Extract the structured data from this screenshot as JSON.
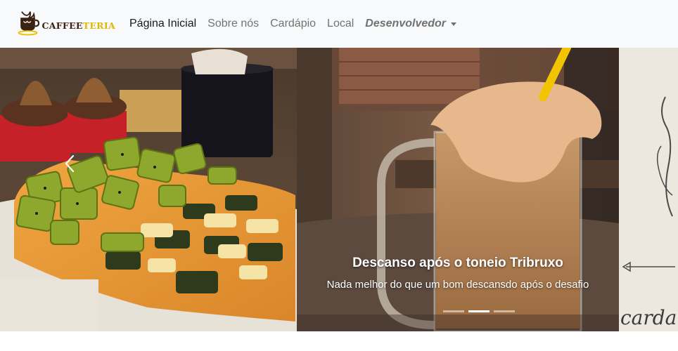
{
  "brand": {
    "name_part1": "CAFFEE",
    "name_part2": "TERIA",
    "logo_icon": "coffee-cup-logo"
  },
  "nav": {
    "items": [
      {
        "label": "Página Inicial",
        "active": true
      },
      {
        "label": "Sobre nós",
        "active": false
      },
      {
        "label": "Cardápio",
        "active": false
      },
      {
        "label": "Local",
        "active": false
      }
    ],
    "dropdown": {
      "label": "Desenvolvedor",
      "icon": "caret-down-icon"
    }
  },
  "carousel": {
    "active_slide": 2,
    "slide_count": 3,
    "caption": {
      "title": "Descanso após o toneio Tribruxo",
      "text": "Nada melhor do que um bom descansdo após o desafio"
    },
    "slide3_text": "carda",
    "prev_icon": "chevron-left-icon",
    "colors": {
      "accent_yellow": "#f2c400",
      "nav_bg": "#f8f9fa"
    }
  }
}
